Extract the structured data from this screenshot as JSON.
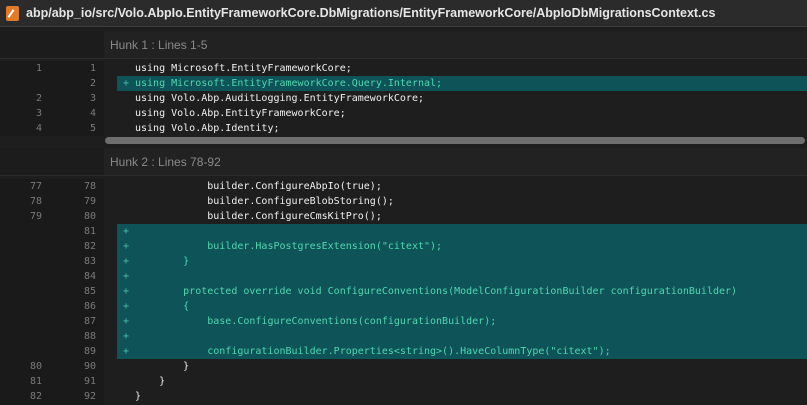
{
  "title": {
    "path": "abp/abp_io/src/Volo.AbpIo.EntityFrameworkCore.DbMigrations/EntityFrameworkCore/AbpIoDbMigrationsContext.cs",
    "icon": "swift-file-icon"
  },
  "hunks": [
    {
      "header": "Hunk 1 : Lines 1-5",
      "lines": [
        {
          "old": "1",
          "new": "1",
          "type": "context",
          "marker": "",
          "code": "using Microsoft.EntityFrameworkCore;"
        },
        {
          "old": "",
          "new": "2",
          "type": "added",
          "marker": "+",
          "code": "using Microsoft.EntityFrameworkCore.Query.Internal;"
        },
        {
          "old": "2",
          "new": "3",
          "type": "context",
          "marker": "",
          "code": "using Volo.Abp.AuditLogging.EntityFrameworkCore;"
        },
        {
          "old": "3",
          "new": "4",
          "type": "context",
          "marker": "",
          "code": "using Volo.Abp.EntityFrameworkCore;"
        },
        {
          "old": "4",
          "new": "5",
          "type": "context",
          "marker": "",
          "code": "using Volo.Abp.Identity;"
        }
      ]
    },
    {
      "header": "Hunk 2 : Lines 78-92",
      "lines": [
        {
          "old": "77",
          "new": "78",
          "type": "context",
          "marker": "",
          "code": "            builder.ConfigureAbpIo(true);"
        },
        {
          "old": "78",
          "new": "79",
          "type": "context",
          "marker": "",
          "code": "            builder.ConfigureBlobStoring();"
        },
        {
          "old": "79",
          "new": "80",
          "type": "context",
          "marker": "",
          "code": "            builder.ConfigureCmsKitPro();"
        },
        {
          "old": "",
          "new": "81",
          "type": "added",
          "marker": "+",
          "code": ""
        },
        {
          "old": "",
          "new": "82",
          "type": "added",
          "marker": "+",
          "code": "            builder.HasPostgresExtension(\"citext\");"
        },
        {
          "old": "",
          "new": "83",
          "type": "added",
          "marker": "+",
          "code": "        }"
        },
        {
          "old": "",
          "new": "84",
          "type": "added",
          "marker": "+",
          "code": ""
        },
        {
          "old": "",
          "new": "85",
          "type": "added",
          "marker": "+",
          "code": "        protected override void ConfigureConventions(ModelConfigurationBuilder configurationBuilder)"
        },
        {
          "old": "",
          "new": "86",
          "type": "added",
          "marker": "+",
          "code": "        {"
        },
        {
          "old": "",
          "new": "87",
          "type": "added",
          "marker": "+",
          "code": "            base.ConfigureConventions(configurationBuilder);"
        },
        {
          "old": "",
          "new": "88",
          "type": "added",
          "marker": "+",
          "code": ""
        },
        {
          "old": "",
          "new": "89",
          "type": "added",
          "marker": "+",
          "code": "            configurationBuilder.Properties<string>().HaveColumnType(\"citext\");"
        },
        {
          "old": "80",
          "new": "90",
          "type": "context",
          "marker": "",
          "code": "        }"
        },
        {
          "old": "81",
          "new": "91",
          "type": "context",
          "marker": "",
          "code": "    }"
        },
        {
          "old": "82",
          "new": "92",
          "type": "context",
          "marker": "",
          "code": "}"
        }
      ]
    }
  ]
}
